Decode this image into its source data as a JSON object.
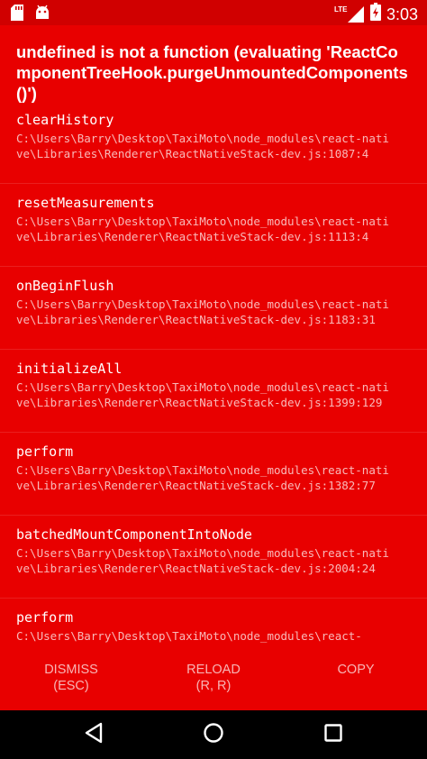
{
  "status_bar": {
    "time": "3:03",
    "network_label": "LTE",
    "icons": [
      "sd-card-icon",
      "android-debug-icon",
      "signal-icon",
      "battery-icon"
    ]
  },
  "error": {
    "title": "undefined is not a function (evaluating 'ReactComponentTreeHook.purgeUnmountedComponents()')"
  },
  "stack": [
    {
      "method": "clearHistory",
      "file": "C:\\Users\\Barry\\Desktop\\TaxiMoto\\node_modules\\react-native\\Libraries\\Renderer\\ReactNativeStack-dev.js:1087:4"
    },
    {
      "method": "resetMeasurements",
      "file": "C:\\Users\\Barry\\Desktop\\TaxiMoto\\node_modules\\react-native\\Libraries\\Renderer\\ReactNativeStack-dev.js:1113:4"
    },
    {
      "method": "onBeginFlush",
      "file": "C:\\Users\\Barry\\Desktop\\TaxiMoto\\node_modules\\react-native\\Libraries\\Renderer\\ReactNativeStack-dev.js:1183:31"
    },
    {
      "method": "initializeAll",
      "file": "C:\\Users\\Barry\\Desktop\\TaxiMoto\\node_modules\\react-native\\Libraries\\Renderer\\ReactNativeStack-dev.js:1399:129"
    },
    {
      "method": "perform",
      "file": "C:\\Users\\Barry\\Desktop\\TaxiMoto\\node_modules\\react-native\\Libraries\\Renderer\\ReactNativeStack-dev.js:1382:77"
    },
    {
      "method": "batchedMountComponentIntoNode",
      "file": "C:\\Users\\Barry\\Desktop\\TaxiMoto\\node_modules\\react-native\\Libraries\\Renderer\\ReactNativeStack-dev.js:2004:24"
    },
    {
      "method": "perform",
      "file": "C:\\Users\\Barry\\Desktop\\TaxiMoto\\node_modules\\react-"
    }
  ],
  "footer": {
    "dismiss_label": "DISMISS",
    "dismiss_shortcut": "(ESC)",
    "reload_label": "RELOAD",
    "reload_shortcut": "(R, R)",
    "copy_label": "COPY"
  },
  "nav_bar": {
    "icons": [
      "back-icon",
      "home-icon",
      "recents-icon"
    ]
  },
  "colors": {
    "background": "#e80000",
    "status_bar": "#d00000",
    "text": "#ffffff",
    "nav_bar": "#000000"
  }
}
